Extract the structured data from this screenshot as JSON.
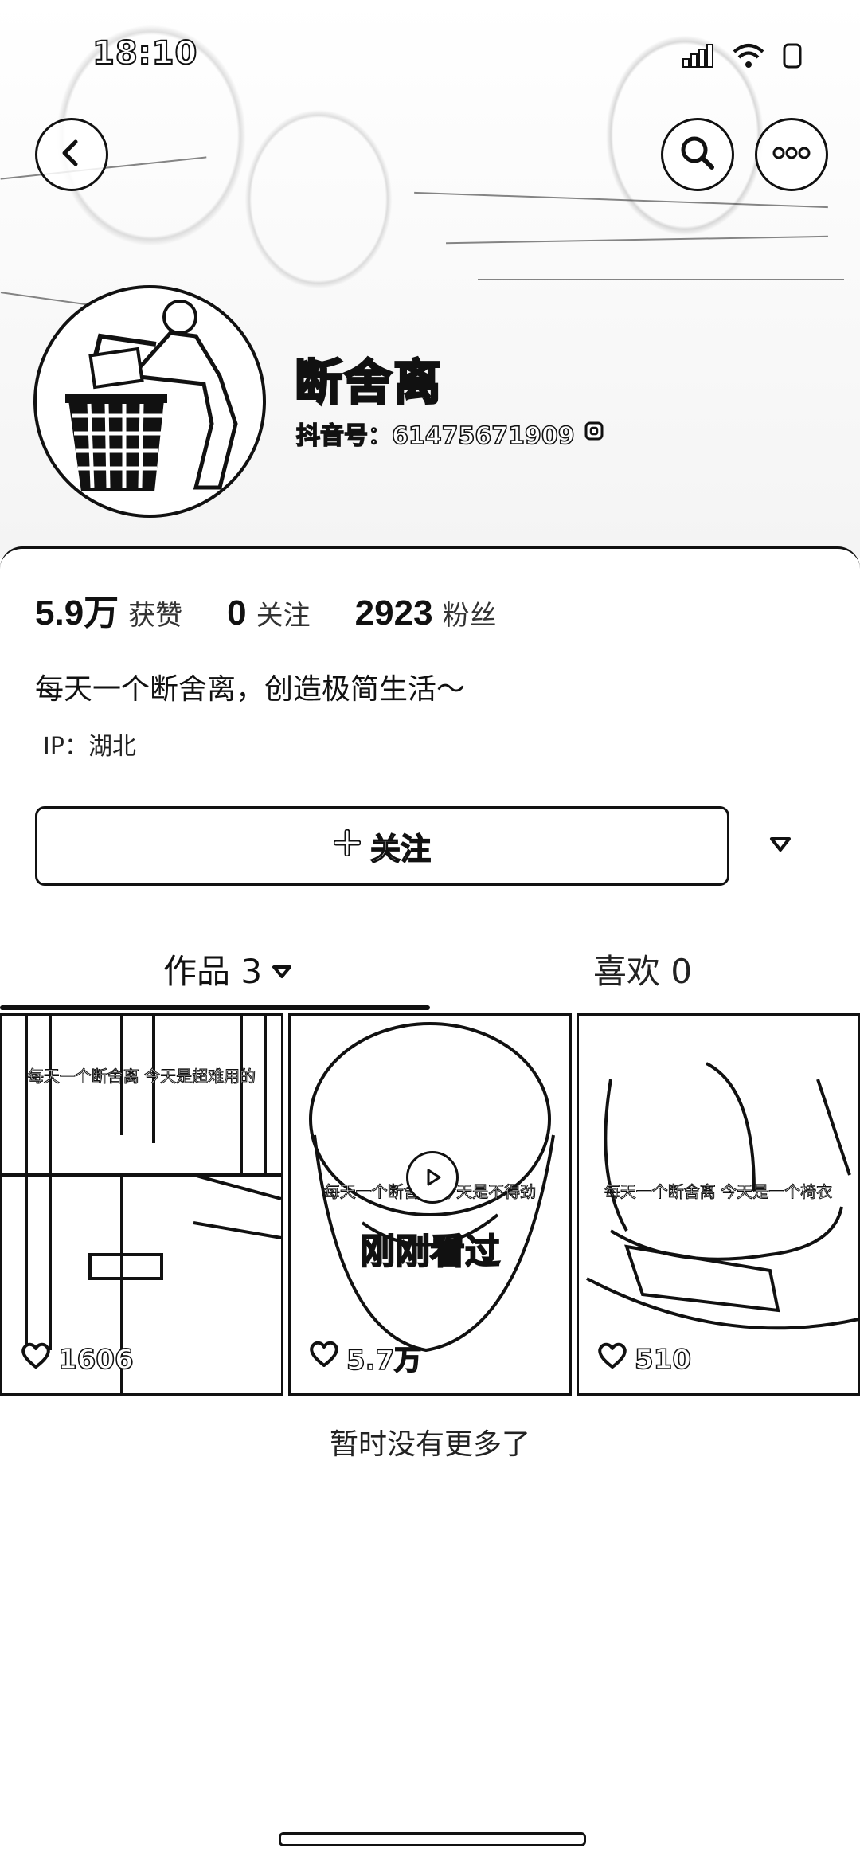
{
  "status_bar": {
    "time": "18:10"
  },
  "profile": {
    "name": "断舍离",
    "douyin_id": "抖音号：61475671909"
  },
  "stats": [
    {
      "value": "5.9万",
      "label": "获赞"
    },
    {
      "value": "0",
      "label": "关注"
    },
    {
      "value": "2923",
      "label": "粉丝"
    }
  ],
  "bio": "每天一个断舍离，创造极简生活～",
  "ip": "IP：湖北",
  "follow_button": {
    "label": "关注"
  },
  "tabs": {
    "works": {
      "label": "作品 3"
    },
    "likes": {
      "label": "喜欢 0"
    }
  },
  "videos": [
    {
      "caption": "每天一个断舍离 今天是超难用的",
      "likes": "1606"
    },
    {
      "caption": "每天一个断舍离 今天是不得劲",
      "likes": "5.7万",
      "overlay": "刚刚看过"
    },
    {
      "caption": "每天一个断舍离 今天是一个椅衣",
      "likes": "510"
    }
  ],
  "end_text": "暂时没有更多了",
  "icons": {
    "back": "chevron-left-icon",
    "search": "search-icon",
    "more": "more-icon",
    "copy": "copy-icon",
    "heart": "heart-icon",
    "play": "play-icon"
  }
}
